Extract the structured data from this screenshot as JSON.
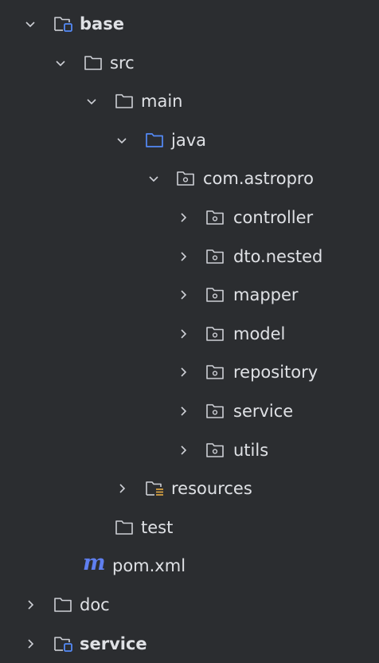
{
  "project_tree": {
    "base": {
      "label": "base",
      "icon": "module-folder-icon",
      "expanded": true
    },
    "src": {
      "label": "src",
      "icon": "folder-icon",
      "expanded": true
    },
    "main": {
      "label": "main",
      "icon": "folder-icon",
      "expanded": true
    },
    "java": {
      "label": "java",
      "icon": "source-root-folder-icon",
      "expanded": true
    },
    "com_astropro": {
      "label": "com.astropro",
      "icon": "package-icon",
      "expanded": true
    },
    "packages": [
      {
        "label": "controller",
        "icon": "package-icon",
        "expanded": false
      },
      {
        "label": "dto.nested",
        "icon": "package-icon",
        "expanded": false
      },
      {
        "label": "mapper",
        "icon": "package-icon",
        "expanded": false
      },
      {
        "label": "model",
        "icon": "package-icon",
        "expanded": false
      },
      {
        "label": "repository",
        "icon": "package-icon",
        "expanded": false
      },
      {
        "label": "service",
        "icon": "package-icon",
        "expanded": false
      },
      {
        "label": "utils",
        "icon": "package-icon",
        "expanded": false
      }
    ],
    "resources": {
      "label": "resources",
      "icon": "resources-folder-icon",
      "expanded": false
    },
    "test": {
      "label": "test",
      "icon": "folder-icon"
    },
    "pom": {
      "label": "pom.xml",
      "icon": "maven-m-icon",
      "glyph": "m"
    },
    "doc": {
      "label": "doc",
      "icon": "folder-icon",
      "expanded": false
    },
    "service_module": {
      "label": "service",
      "icon": "module-folder-icon",
      "expanded": false
    }
  },
  "colors": {
    "background": "#2b2d30",
    "text": "#dfe1e5",
    "icon_stroke": "#ced0d6",
    "accent_blue": "#548af7",
    "resources_yellow": "#d9a343",
    "maven_blue": "#5f7ff0"
  }
}
